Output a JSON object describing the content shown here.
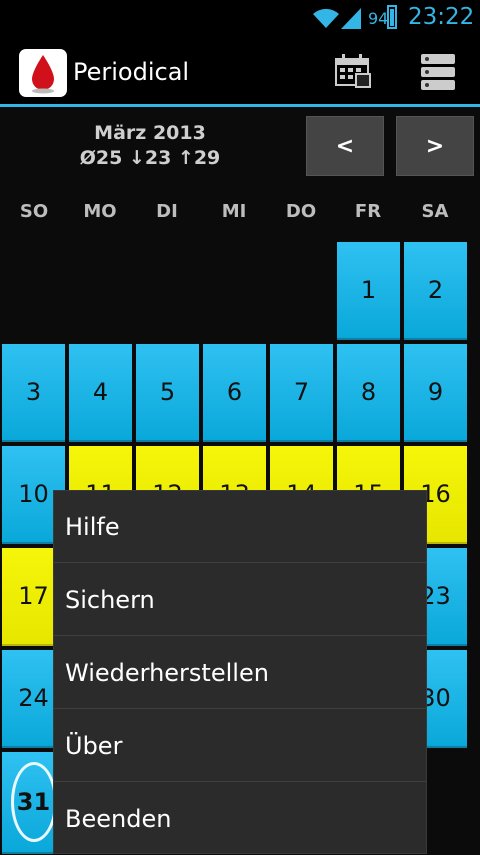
{
  "status": {
    "battery": "94",
    "time": "23:22"
  },
  "app": {
    "title": "Periodical"
  },
  "actionbar": {
    "icons": [
      "calendar-icon",
      "list-icon"
    ]
  },
  "header": {
    "month": "März 2013",
    "stats": "Ø25 ↓23 ↑29",
    "prev": "<",
    "next": ">"
  },
  "weekdays": [
    "SO",
    "MO",
    "DI",
    "MI",
    "DO",
    "FR",
    "SA"
  ],
  "days": {
    "d1": "1",
    "d2": "2",
    "d3": "3",
    "d4": "4",
    "d5": "5",
    "d6": "6",
    "d7": "7",
    "d8": "8",
    "d9": "9",
    "d10": "10",
    "d11": "11",
    "d12": "12",
    "d13": "13",
    "d14": "14",
    "d15": "15",
    "d16": "16",
    "d17": "17",
    "d23": "23",
    "d24": "24",
    "d30": "30",
    "d31": "31"
  },
  "menu": [
    "Hilfe",
    "Sichern",
    "Wiederherstellen",
    "Über",
    "Beenden"
  ],
  "colors": {
    "accent": "#33b5e5",
    "cycle_day": "#1ab4e8",
    "period_day": "#f2f205",
    "background": "#0b0b0b"
  }
}
